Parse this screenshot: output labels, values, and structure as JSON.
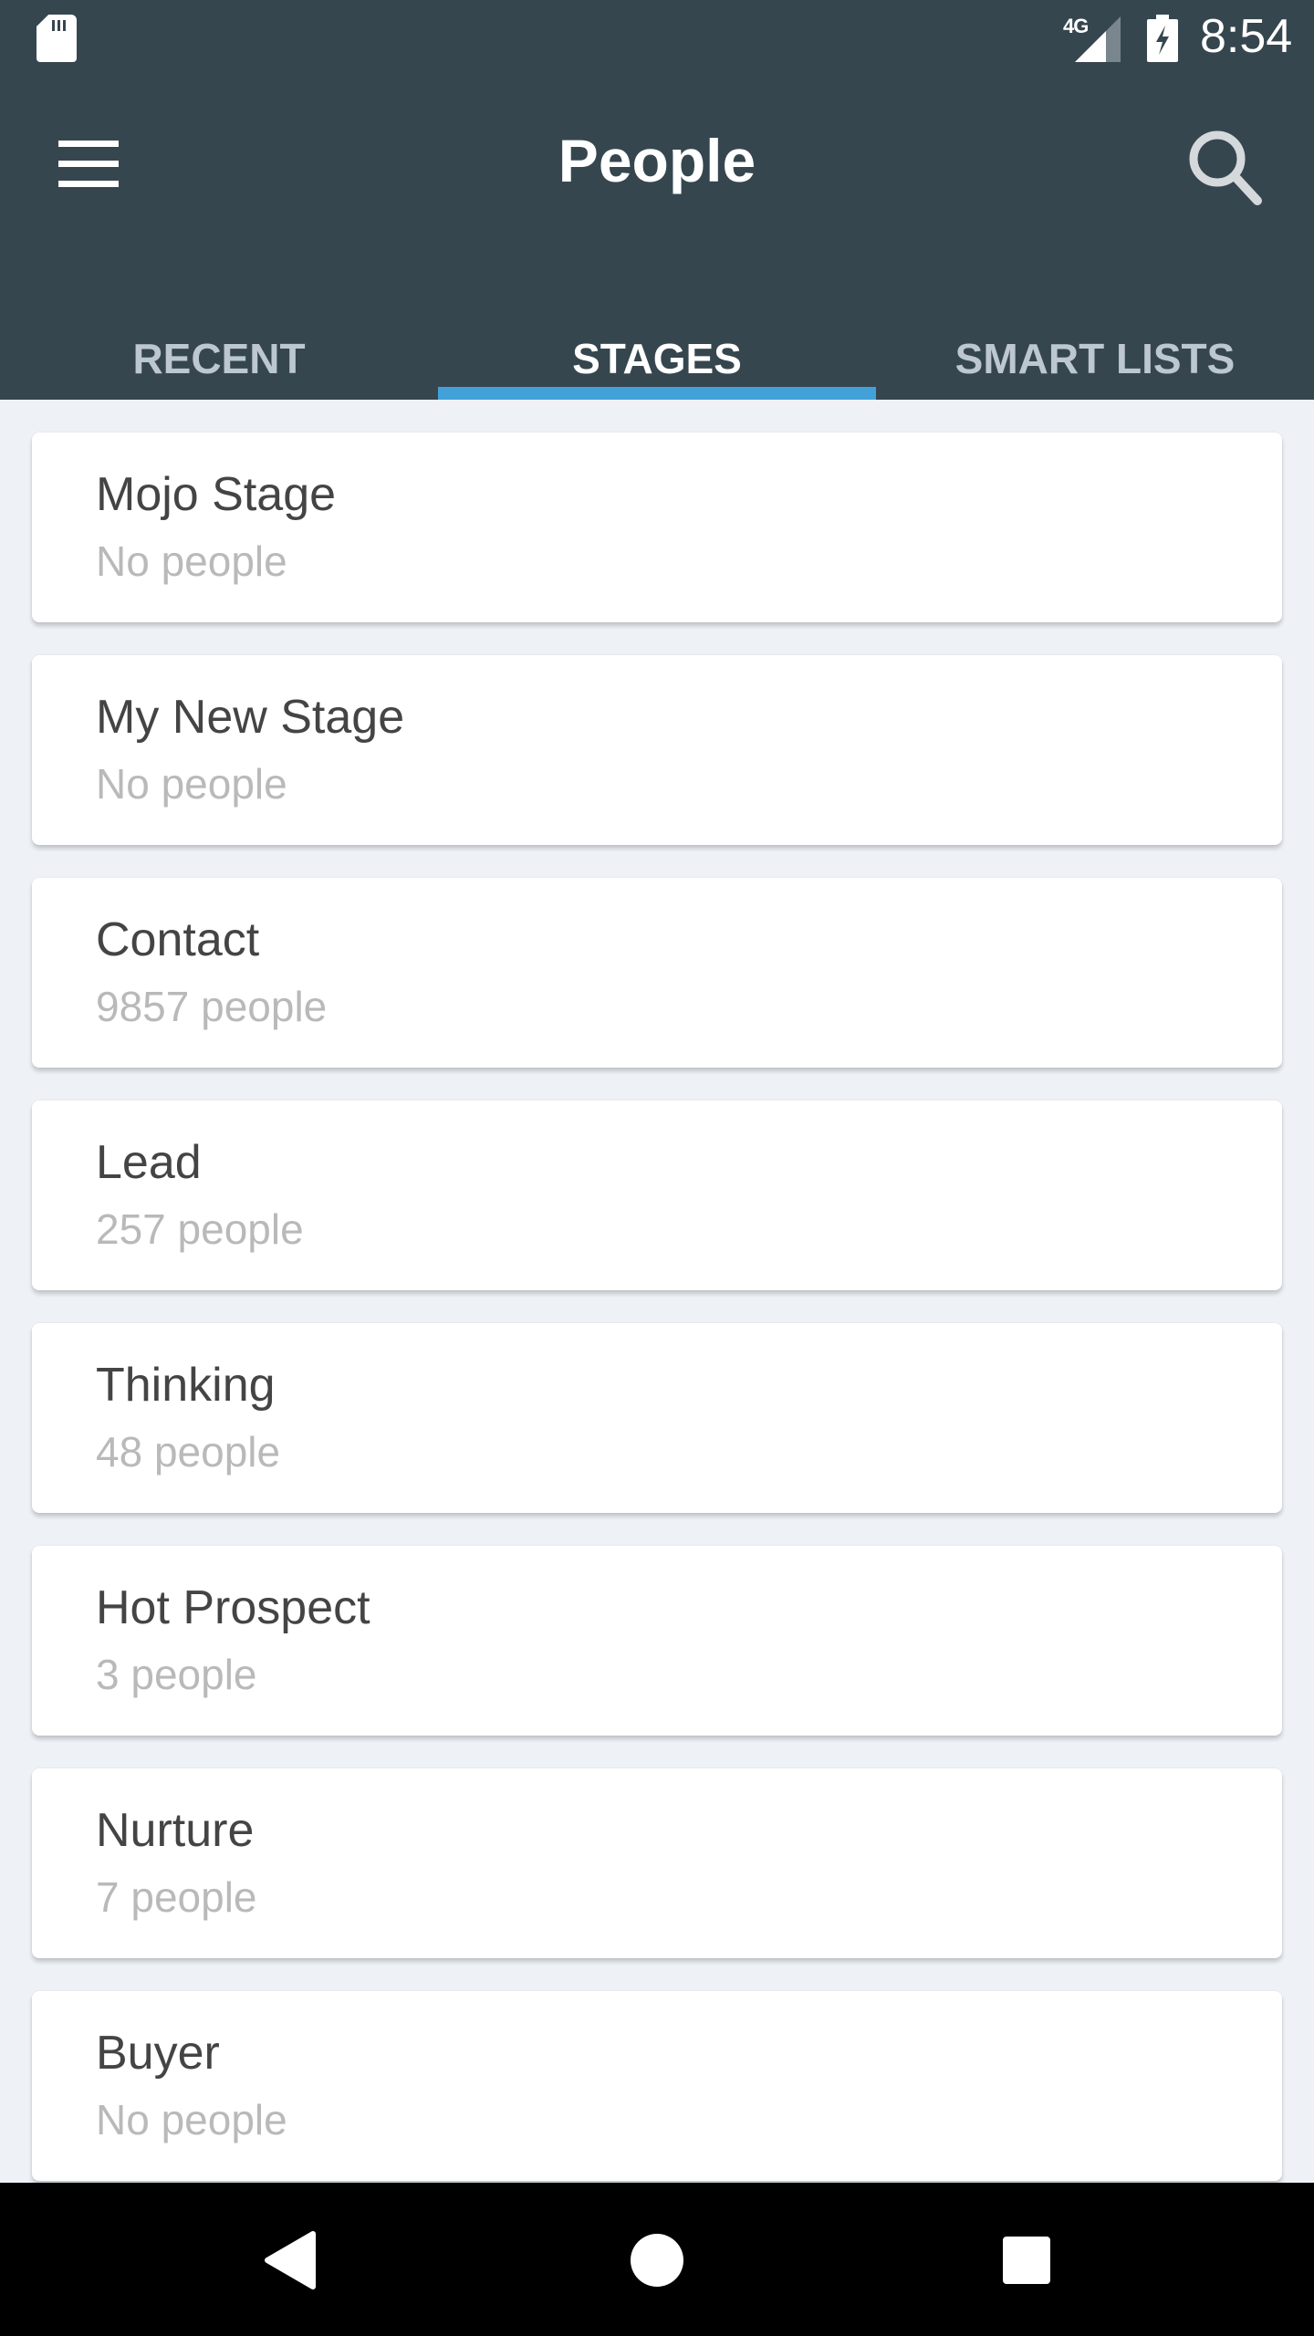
{
  "status_bar": {
    "network_label": "4G",
    "time": "8:54",
    "icons": [
      "sd-card-icon",
      "signal-icon",
      "battery-charging-icon"
    ]
  },
  "app_bar": {
    "title": "People",
    "menu_icon": "hamburger-menu-icon",
    "search_icon": "search-icon"
  },
  "tabs": [
    {
      "label": "RECENT",
      "active": false
    },
    {
      "label": "STAGES",
      "active": true
    },
    {
      "label": "SMART LISTS",
      "active": false
    }
  ],
  "colors": {
    "header_bg": "#36464f",
    "tab_indicator": "#42a1d9",
    "background": "#eef2f7"
  },
  "stages": [
    {
      "name": "Mojo Stage",
      "count": "No people"
    },
    {
      "name": "My New Stage",
      "count": "No people"
    },
    {
      "name": "Contact",
      "count": "9857 people"
    },
    {
      "name": "Lead",
      "count": "257 people"
    },
    {
      "name": "Thinking",
      "count": "48 people"
    },
    {
      "name": "Hot Prospect",
      "count": "3 people"
    },
    {
      "name": "Nurture",
      "count": "7 people"
    },
    {
      "name": "Buyer",
      "count": "No people"
    }
  ],
  "nav_bar": {
    "buttons": [
      "back-icon",
      "home-icon",
      "recents-icon"
    ]
  }
}
